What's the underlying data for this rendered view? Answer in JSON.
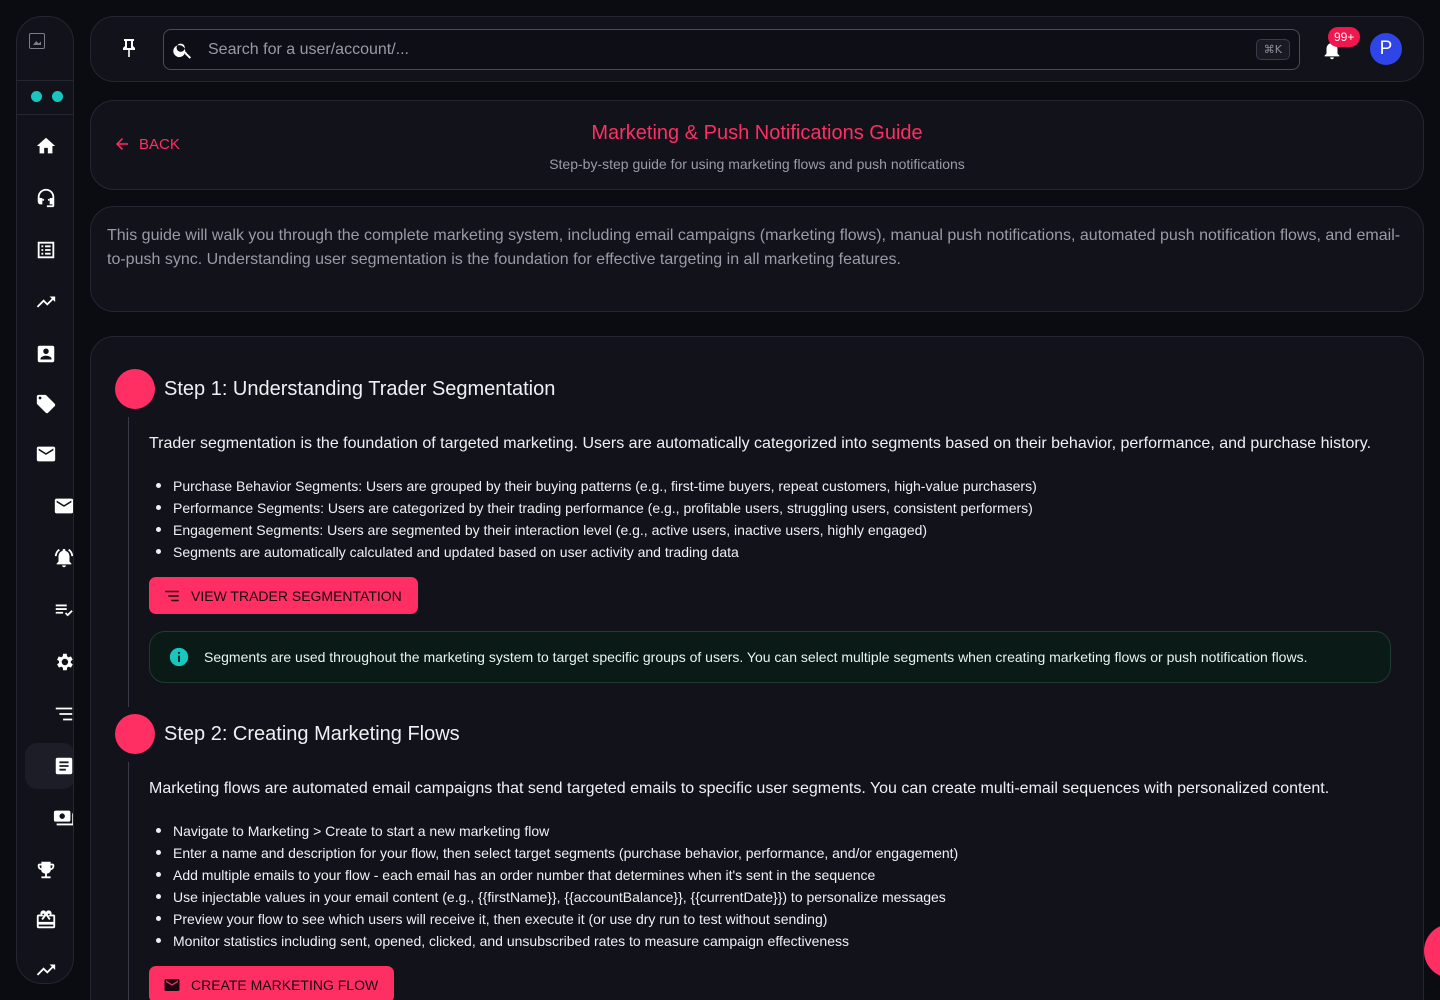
{
  "topbar": {
    "search_placeholder": "Search for a user/account/...",
    "search_shortcut": "⌘K",
    "notification_count": "99+",
    "avatar_initial": "P"
  },
  "header": {
    "back_label": "BACK",
    "title": "Marketing & Push Notifications Guide",
    "subtitle": "Step-by-step guide for using marketing flows and push notifications"
  },
  "intro": {
    "text": "This guide will walk you through the complete marketing system, including email campaigns (marketing flows), manual push notifications, automated push notification flows, and email-to-push sync. Understanding user segmentation is the foundation for effective targeting in all marketing features."
  },
  "steps": [
    {
      "title": "Step 1: Understanding Trader Segmentation",
      "description": "Trader segmentation is the foundation of targeted marketing. Users are automatically categorized into segments based on their behavior, performance, and purchase history.",
      "items": [
        "Purchase Behavior Segments: Users are grouped by their buying patterns (e.g., first-time buyers, repeat customers, high-value purchasers)",
        "Performance Segments: Users are categorized by their trading performance (e.g., profitable users, struggling users, consistent performers)",
        "Engagement Segments: Users are segmented by their interaction level (e.g., active users, inactive users, highly engaged)",
        "Segments are automatically calculated and updated based on user activity and trading data"
      ],
      "button_label": "VIEW TRADER SEGMENTATION",
      "info": "Segments are used throughout the marketing system to target specific groups of users. You can select multiple segments when creating marketing flows or push notification flows."
    },
    {
      "title": "Step 2: Creating Marketing Flows",
      "description": "Marketing flows are automated email campaigns that send targeted emails to specific user segments. You can create multi-email sequences with personalized content.",
      "items": [
        "Navigate to Marketing > Create to start a new marketing flow",
        "Enter a name and description for your flow, then select target segments (purchase behavior, performance, and/or engagement)",
        "Add multiple emails to your flow - each email has an order number that determines when it's sent in the sequence",
        "Use injectable values in your email content (e.g., {{firstName}}, {{accountBalance}}, {{currentDate}}) to personalize messages",
        "Preview your flow to see which users will receive it, then execute it (or use dry run to test without sending)",
        "Monitor statistics including sent, opened, clicked, and unsubscribed rates to measure campaign effectiveness"
      ],
      "button_label": "CREATE MARKETING FLOW"
    }
  ],
  "sidebar": {
    "icons": [
      "home-icon",
      "support-agent-icon",
      "list-icon",
      "trending-up-icon",
      "account-box-icon",
      "tag-icon",
      "mail-icon",
      "email-icon",
      "notifications-active-icon",
      "playlist-check-icon",
      "settings-icon",
      "sort-icon",
      "article-icon",
      "payments-icon",
      "trophy-icon",
      "gift-card-icon",
      "trending-up-icon"
    ]
  },
  "colors": {
    "accent": "#ff2e63",
    "teal": "#17c6bf",
    "avatar": "#2f45e8",
    "background": "#0b0b12",
    "card": "#12121b"
  }
}
